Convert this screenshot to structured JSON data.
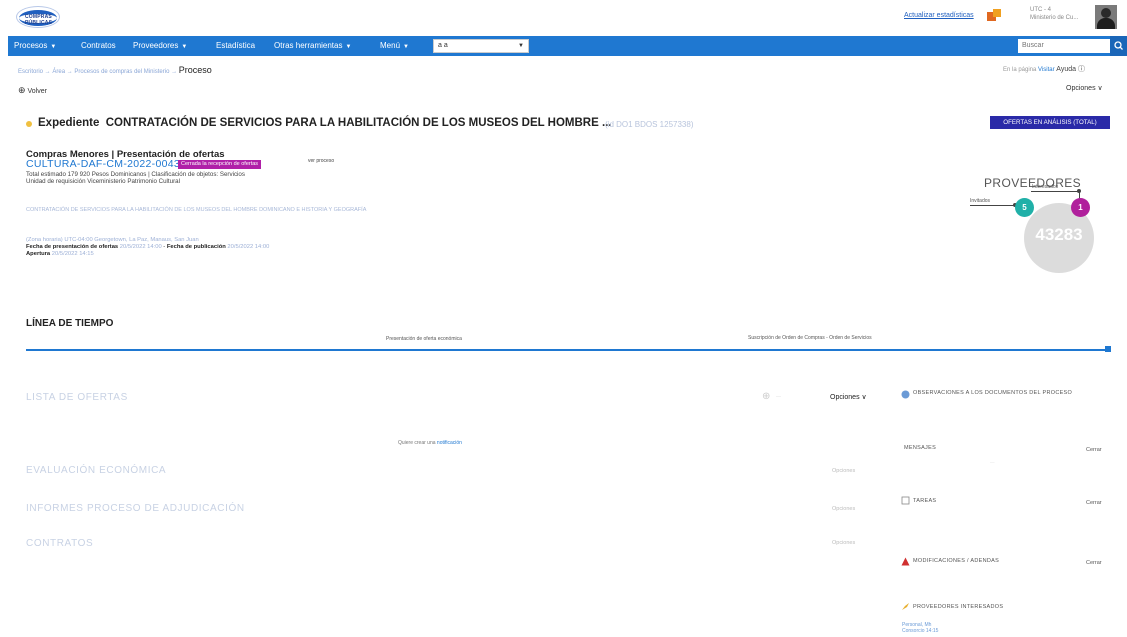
{
  "header": {
    "logo_text": "COMPRAS PÚBLICAS",
    "link_label": "Actualizar estadísticas",
    "user_name": "UTC - 4",
    "user_org": "Ministerio de Cu..."
  },
  "nav": {
    "items": [
      {
        "label": "Procesos",
        "dropdown": true
      },
      {
        "label": "Contratos",
        "dropdown": false
      },
      {
        "label": "Proveedores",
        "dropdown": true
      },
      {
        "label": "Estadística",
        "dropdown": false
      },
      {
        "label": "Otras herramientas",
        "dropdown": true
      },
      {
        "label": "Menú",
        "dropdown": true
      }
    ],
    "select_value": "a a",
    "search_placeholder": "Buscar"
  },
  "breadcrumb": {
    "parts": [
      "Escritorio",
      "Área",
      "Procesos de compras del Ministerio"
    ],
    "current": "Proceso"
  },
  "topright": {
    "text": "En la página",
    "link": "Visitar",
    "help": "Ayuda"
  },
  "back_label": "Volver",
  "options_label": "Opciones",
  "expediente": {
    "label": "Expediente",
    "title": "CONTRATACIÓN DE SERVICIOS PARA LA HABILITACIÓN DE LOS MUSEOS DEL HOMBRE ...",
    "id": "(id DO1 BDOS 1257338)",
    "status": "OFERTAS EN ANÁLISIS (TOTAL)"
  },
  "process": {
    "title": "Compras Menores | Presentación de ofertas",
    "code": "CULTURA-DAF-CM-2022-0043",
    "badge": "Cerrada la recepción de ofertas",
    "view_link": "ver proceso",
    "estimated": "Total estimado 179 920 Pesos Dominicanos | Clasificación de objetos: Servicios",
    "unit": "Unidad de requisición Viceministerio Patrimonio Cultural",
    "description": "CONTRATACIÓN DE SERVICIOS PARA LA HABILITACIÓN DE LOS MUSEOS DEL HOMBRE DOMINICANO E HISTORIA Y GEOGRAFÍA",
    "timezone_line": "(Zona horaria) UTC-04:00 Georgetown, La Paz, Manaus, San Juan",
    "fecha_presentacion_label": "Fecha de presentación de ofertas",
    "fecha_presentacion": "20/5/2022 14:00",
    "fecha_publicacion_label": "Fecha de publicación",
    "fecha_publicacion": "20/5/2022 14:00",
    "apertura_label": "Apertura",
    "apertura": "20/5/2022 14:15"
  },
  "proveedores": {
    "title": "PROVEEDORES",
    "big_number": "43283",
    "invited_label": "Invitados",
    "invited_count": "5",
    "interested_label": "Interesados",
    "interested_count": "1"
  },
  "timeline": {
    "title": "LÍNEA DE TIEMPO",
    "stage1": "Presentación de oferta económica",
    "stage2": "Suscripción de Orden de Compras - Orden de Servicios"
  },
  "sections": {
    "lista_ofertas": "LISTA DE OFERTAS",
    "lista_options": "Opciones",
    "notice_text": "Quiere crear una",
    "notice_link": "notificación",
    "evaluacion": "EVALUACIÓN ECONÓMICA",
    "informes": "INFORMES PROCESO DE ADJUDICACIÓN",
    "contratos": "CONTRATOS",
    "ghost_options": "Opciones"
  },
  "right_panel": {
    "observaciones": "OBSERVACIONES A LOS DOCUMENTOS DEL PROCESO",
    "mensajes": "MENSAJES",
    "tareas": "TAREAS",
    "modificaciones": "MODIFICACIONES / ADENDAS",
    "proveedores_interesados": "PROVEEDORES INTERESADOS",
    "cerrar": "Cerrar",
    "prov_link_1": "Personal, Mh",
    "prov_link_2": "Consorcio 14:15"
  },
  "colors": {
    "nav_blue": "#1f78d1",
    "status_badge": "#2a2aa8",
    "magenta": "#b0209c",
    "teal": "#20b0a8"
  }
}
